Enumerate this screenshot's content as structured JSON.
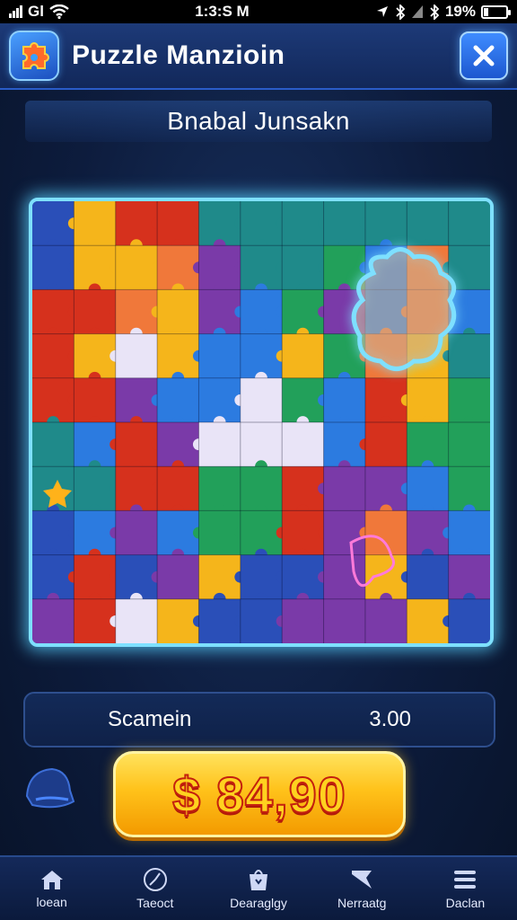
{
  "status_bar": {
    "carrier": "Gl",
    "time": "1:3:S M",
    "battery": "19%"
  },
  "header": {
    "title": "Puzzle Manzioin",
    "app_icon": "puzzle-app-icon",
    "close_icon": "close-icon"
  },
  "level": {
    "title": "Bnabal Junsakn"
  },
  "board": {
    "rows": 10,
    "cols": 11,
    "highlight_color": "#7ee0ff"
  },
  "score": {
    "label": "Scamein",
    "value": "3.00"
  },
  "hint": {
    "icon": "hat-icon"
  },
  "purchase": {
    "label": "$ 84,90"
  },
  "nav": {
    "items": [
      {
        "label": "loean",
        "icon": "home-icon"
      },
      {
        "label": "Taeoct",
        "icon": "clock-icon"
      },
      {
        "label": "Dearaglgy",
        "icon": "bag-icon"
      },
      {
        "label": "Nerraatg",
        "icon": "flag-icon"
      },
      {
        "label": "Daclan",
        "icon": "menu-icon"
      }
    ]
  },
  "colors": {
    "accent": "#7ee0ff",
    "button": "#ffc21a",
    "price_text": "#ffd21f",
    "price_outline": "#c4200e"
  }
}
